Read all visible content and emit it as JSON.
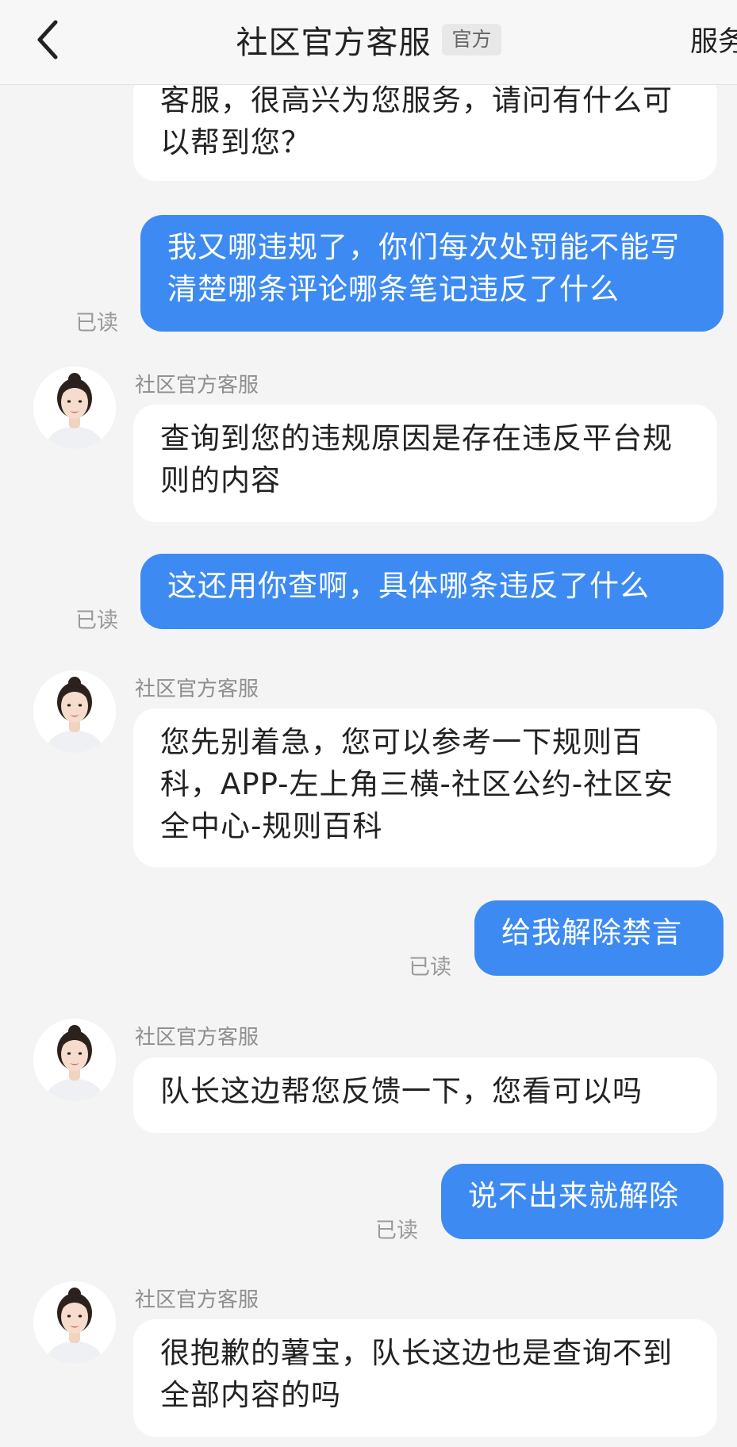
{
  "header": {
    "title": "社区官方客服",
    "badge": "官方",
    "service_label": "服务"
  },
  "messages": [
    {
      "from": "agent",
      "text": "客服，很高兴为您服务，请问有什么可以帮到您？"
    },
    {
      "from": "user",
      "text": "我又哪违规了，你们每次处罚能不能写清楚哪条评论哪条笔记违反了什么",
      "status": "已读"
    },
    {
      "from": "agent",
      "sender": "社区官方客服",
      "text": "查询到您的违规原因是存在违反平台规则的内容"
    },
    {
      "from": "user",
      "text": "这还用你查啊，具体哪条违反了什么",
      "status": "已读"
    },
    {
      "from": "agent",
      "sender": "社区官方客服",
      "text": "您先别着急，您可以参考一下规则百科，APP-左上角三横-社区公约-社区安全中心-规则百科"
    },
    {
      "from": "user",
      "text": "给我解除禁言",
      "status": "已读"
    },
    {
      "from": "agent",
      "sender": "社区官方客服",
      "text": "队长这边帮您反馈一下，您看可以吗"
    },
    {
      "from": "user",
      "text": "说不出来就解除",
      "status": "已读"
    },
    {
      "from": "agent",
      "sender": "社区官方客服",
      "text": "很抱歉的薯宝，队长这边也是查询不到全部内容的吗"
    }
  ],
  "icons": {
    "back": "chevron-left-icon",
    "avatar": "agent-avatar"
  },
  "colors": {
    "outgoing_bubble": "#3d8bf2",
    "incoming_bubble": "#ffffff",
    "background": "#f4f4f4"
  }
}
